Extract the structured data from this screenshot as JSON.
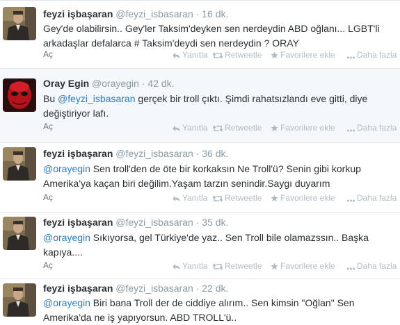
{
  "tweets": [
    {
      "name": "feyzi işbaşaran",
      "handle": "@feyzi_isbasaran",
      "time": "16 dk.",
      "segments": [
        {
          "t": "Gey'de olabilirsin.. Gey'ler Taksim'deyken sen nerdeydin ABD oğlanı... LGBT'li arkadaşlar defalarca # Taksim'deydi sen nerdeydin ? ORAY",
          "m": false
        }
      ],
      "expand": "Aç",
      "avatar": "portrait-avatar"
    },
    {
      "name": "Oray Egin",
      "handle": "@orayegin",
      "time": "42 dk.",
      "segments": [
        {
          "t": "Bu ",
          "m": false
        },
        {
          "t": "@feyzi_isbasaran",
          "m": true
        },
        {
          "t": " gerçek bir troll çıktı. Şimdi rahatsızlandı eve gitti, diye değiştiriyor lafı.",
          "m": false
        }
      ],
      "expand": "Aç",
      "avatar": "masked-avatar"
    },
    {
      "name": "feyzi işbaşaran",
      "handle": "@feyzi_isbasaran",
      "time": "36 dk.",
      "segments": [
        {
          "t": "@orayegin",
          "m": true
        },
        {
          "t": " Sen troll'den de öte bir korkaksın Ne Troll'ü? Senin gibi korkup Amerika'ya kaçan biri değilim.Yaşam tarzın senindir.Saygı duyarım",
          "m": false
        }
      ],
      "expand": "Aç",
      "avatar": "portrait-avatar"
    },
    {
      "name": "feyzi işbaşaran",
      "handle": "@feyzi_isbasaran",
      "time": "35 dk.",
      "segments": [
        {
          "t": "@orayegin",
          "m": true
        },
        {
          "t": " Sıkıyorsa, gel Türkiye'de yaz.. Sen Troll bile olamazssın.. Başka kapıya....",
          "m": false
        }
      ],
      "expand": "Aç",
      "avatar": "portrait-avatar"
    },
    {
      "name": "feyzi işbaşaran",
      "handle": "@feyzi_isbasaran",
      "time": "22 dk.",
      "segments": [
        {
          "t": "@orayegin",
          "m": true
        },
        {
          "t": " Biri bana Troll der de ciddiye alırım.. Sen kimsin \"Oğlan\" Sen Amerika'da ne iş yapıyorsun. ABD TROLL'ü..",
          "m": false
        }
      ],
      "expand": "",
      "avatar": "portrait-avatar"
    }
  ],
  "actions": {
    "reply": "Yanıtla",
    "retweet": "Retweetle",
    "favorite": "Favorilere ekle",
    "more": "Daha fazla"
  },
  "colors": {
    "link": "#2b7bb9",
    "muted": "#8899a6",
    "action": "#b0bcc5",
    "separator": "#e1e8ed"
  }
}
